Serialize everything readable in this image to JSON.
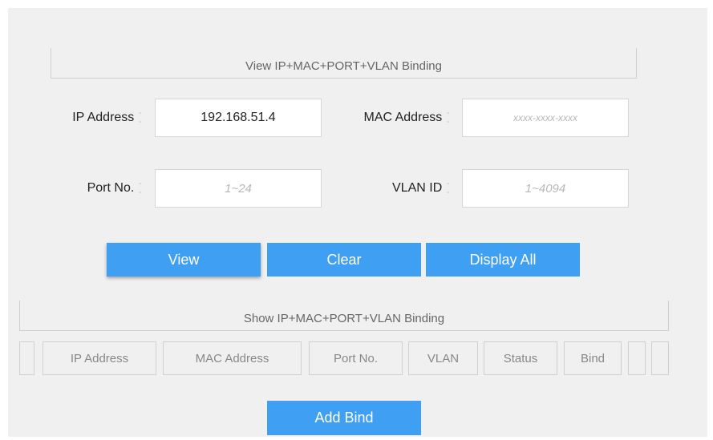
{
  "view_section": {
    "title": "View IP+MAC+PORT+VLAN Binding"
  },
  "form": {
    "ip_label": "IP Address",
    "ip_value": "192.168.51.4",
    "mac_label": "MAC Address",
    "mac_placeholder": "xxxx-xxxx-xxxx",
    "port_label": "Port No.",
    "port_placeholder": "1~24",
    "vlan_label": "VLAN ID",
    "vlan_placeholder": "1~4094"
  },
  "buttons": {
    "view": "View",
    "clear": "Clear",
    "display_all": "Display All"
  },
  "show_section": {
    "title": "Show IP+MAC+PORT+VLAN Binding"
  },
  "table": {
    "columns": [
      "IP Address",
      "MAC Address",
      "Port No.",
      "VLAN",
      "Status",
      "Bind"
    ]
  },
  "add_bind": "Add Bind",
  "colors": {
    "button": "#3fa0f3",
    "panel": "#f0f0f0"
  }
}
